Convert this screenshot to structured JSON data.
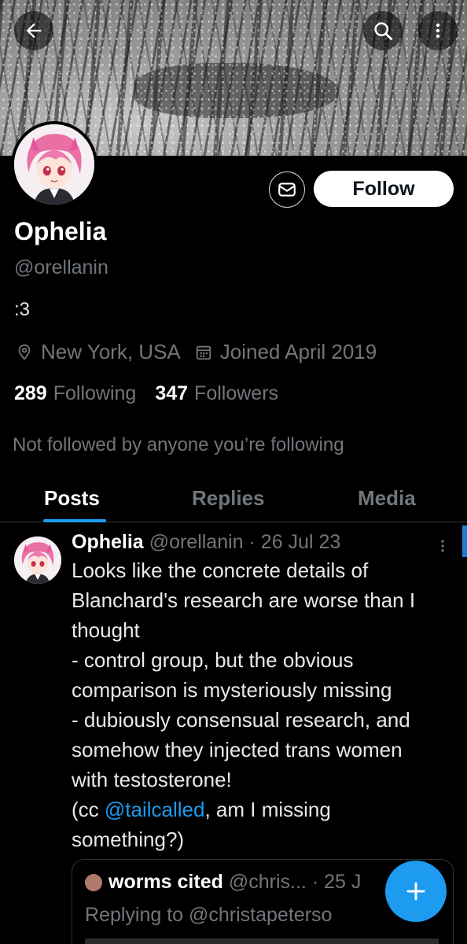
{
  "header": {
    "back_icon": "arrow-left-icon",
    "search_icon": "search-icon",
    "more_icon": "more-vertical-icon"
  },
  "profile": {
    "name": "Ophelia",
    "handle": "@orellanin",
    "bio": ":3",
    "location": "New York, USA",
    "joined": "Joined April 2019",
    "following_count": "289",
    "following_label": "Following",
    "followers_count": "347",
    "followers_label": "Followers",
    "not_followed_text": "Not followed by anyone you’re following",
    "follow_label": "Follow",
    "message_icon": "mail-icon"
  },
  "tabs": [
    {
      "label": "Posts",
      "active": true
    },
    {
      "label": "Replies",
      "active": false
    },
    {
      "label": "Media",
      "active": false
    }
  ],
  "post": {
    "author": "Ophelia",
    "meta": "@orellanin · 26 Jul 23",
    "lines": [
      "Looks like the concrete details of",
      "Blanchard's research are worse than I",
      "thought",
      "- control group, but the obvious",
      "comparison is mysteriously missing",
      "- dubiously consensual research, and",
      "somehow they injected trans women",
      "with testosterone!"
    ],
    "cc_prefix": "(cc ",
    "cc_mention": "@tailcalled",
    "cc_suffix": ", am I missing",
    "last_line": "something?)"
  },
  "quote": {
    "author": "worms cited",
    "meta": "@chris... · 25 J",
    "reply_text": "Replying to @christapeterso"
  },
  "colors": {
    "accent": "#1d9bf0",
    "background": "#000000",
    "muted": "#71767b"
  }
}
